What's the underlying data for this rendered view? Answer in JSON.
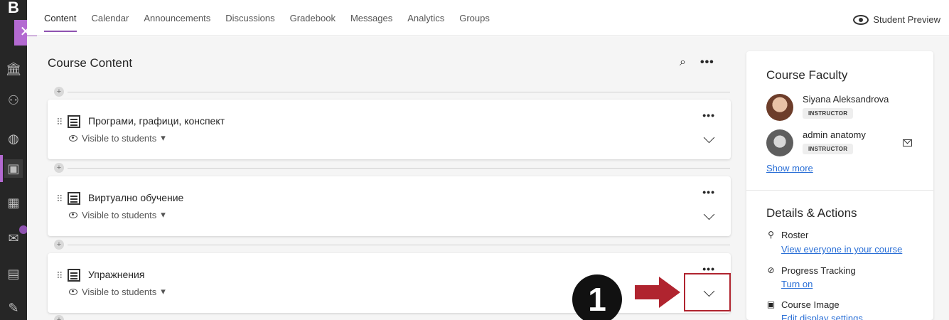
{
  "rail": {
    "logo": "B",
    "close_glyph": "✕"
  },
  "nav": {
    "tabs": [
      {
        "label": "Content"
      },
      {
        "label": "Calendar"
      },
      {
        "label": "Announcements"
      },
      {
        "label": "Discussions"
      },
      {
        "label": "Gradebook"
      },
      {
        "label": "Messages"
      },
      {
        "label": "Analytics"
      },
      {
        "label": "Groups"
      }
    ],
    "student_preview": "Student Preview"
  },
  "content": {
    "title": "Course Content",
    "search_glyph": "🔍",
    "more_glyph": "•••",
    "items": [
      {
        "title": "Програми, графици, конспект",
        "visibility": "Visible to students"
      },
      {
        "title": "Виртуално обучение",
        "visibility": "Visible to students"
      },
      {
        "title": "Упражнения",
        "visibility": "Visible to students"
      }
    ],
    "step_number": "1",
    "accent": "#8e52b0",
    "highlight_color": "#b0242f"
  },
  "panel": {
    "faculty_title": "Course Faculty",
    "faculty": [
      {
        "name": "Siyana Aleksandrova",
        "role": "INSTRUCTOR"
      },
      {
        "name": "admin anatomy",
        "role": "INSTRUCTOR"
      }
    ],
    "show_more": "Show more",
    "details_title": "Details & Actions",
    "actions": [
      {
        "label": "Roster",
        "link": "View everyone in your course"
      },
      {
        "label": "Progress Tracking",
        "link": "Turn on"
      },
      {
        "label": "Course Image",
        "link": "Edit display settings"
      }
    ]
  }
}
